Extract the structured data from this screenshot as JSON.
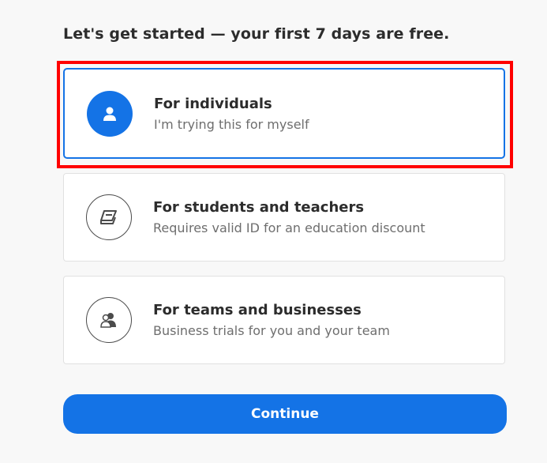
{
  "heading": "Let's get started — your first 7 days are free.",
  "options": [
    {
      "title": "For individuals",
      "subtitle": "I'm trying this for myself",
      "icon": "person-icon",
      "selected": true
    },
    {
      "title": "For students and teachers",
      "subtitle": "Requires valid ID for an education discount",
      "icon": "book-icon",
      "selected": false
    },
    {
      "title": "For teams and businesses",
      "subtitle": "Business trials for you and your team",
      "icon": "group-icon",
      "selected": false
    }
  ],
  "continue_label": "Continue",
  "colors": {
    "accent": "#1473e6",
    "highlight": "#ff0000"
  }
}
